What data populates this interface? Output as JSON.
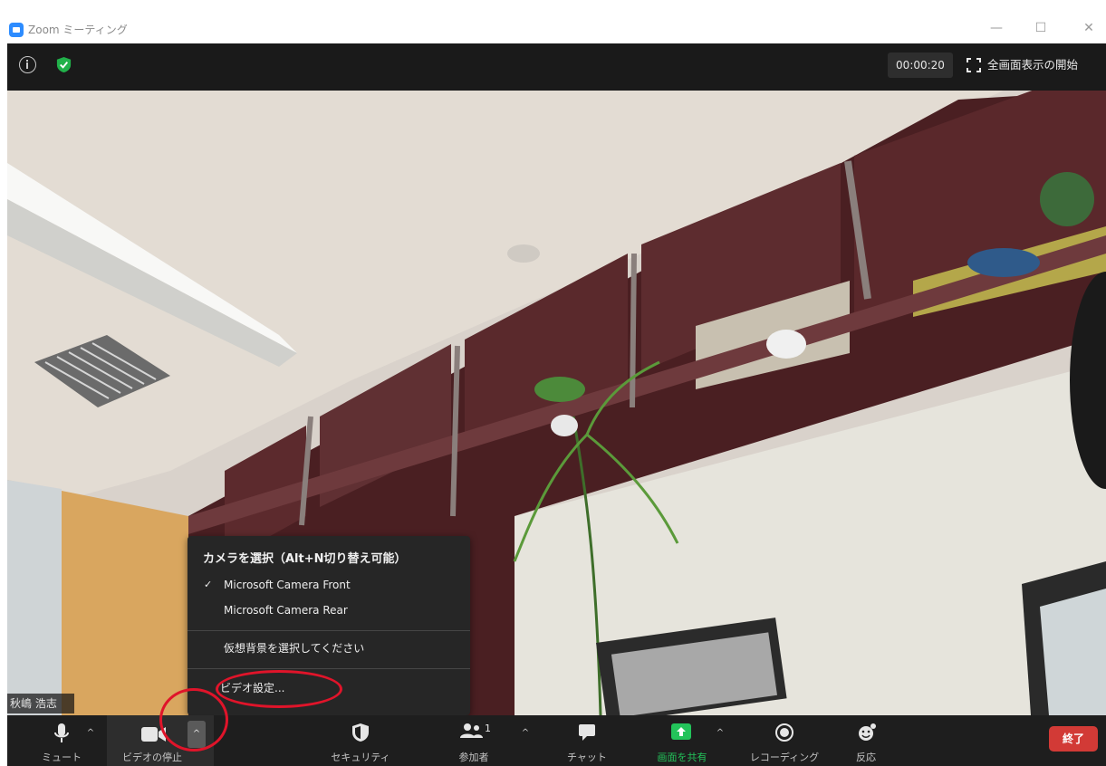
{
  "window": {
    "title": "Zoom ミーティング",
    "minimize_symbol": "—",
    "maximize_symbol": "☐",
    "close_symbol": "✕"
  },
  "meeting_header": {
    "info_icon": "info-icon",
    "security_icon": "shield-check-icon",
    "security_color": "#21b14a",
    "timer": "00:00:20",
    "fullscreen_label": "全画面表示の開始"
  },
  "video": {
    "participant_name": "秋嶋 浩志"
  },
  "camera_menu": {
    "heading": "カメラを選択（Alt+N切り替え可能）",
    "cameras": [
      {
        "label": "Microsoft Camera Front",
        "selected": true,
        "check": "✓"
      },
      {
        "label": "Microsoft Camera Rear",
        "selected": false,
        "check": ""
      }
    ],
    "virtual_background_label": "仮想背景を選択してください",
    "video_settings_label": "ビデオ設定..."
  },
  "toolbar": {
    "mute_label": "ミュート",
    "video_label": "ビデオの停止",
    "security_label": "セキュリティ",
    "participants_label": "参加者",
    "participants_count": "1",
    "chat_label": "チャット",
    "share_label": "画面を共有",
    "record_label": "レコーディング",
    "reactions_label": "反応",
    "end_label": "終了",
    "caret": "^",
    "share_color": "#23c35a",
    "end_color": "#d23a36"
  },
  "annotations": {
    "highlight_color": "#e0142a"
  }
}
